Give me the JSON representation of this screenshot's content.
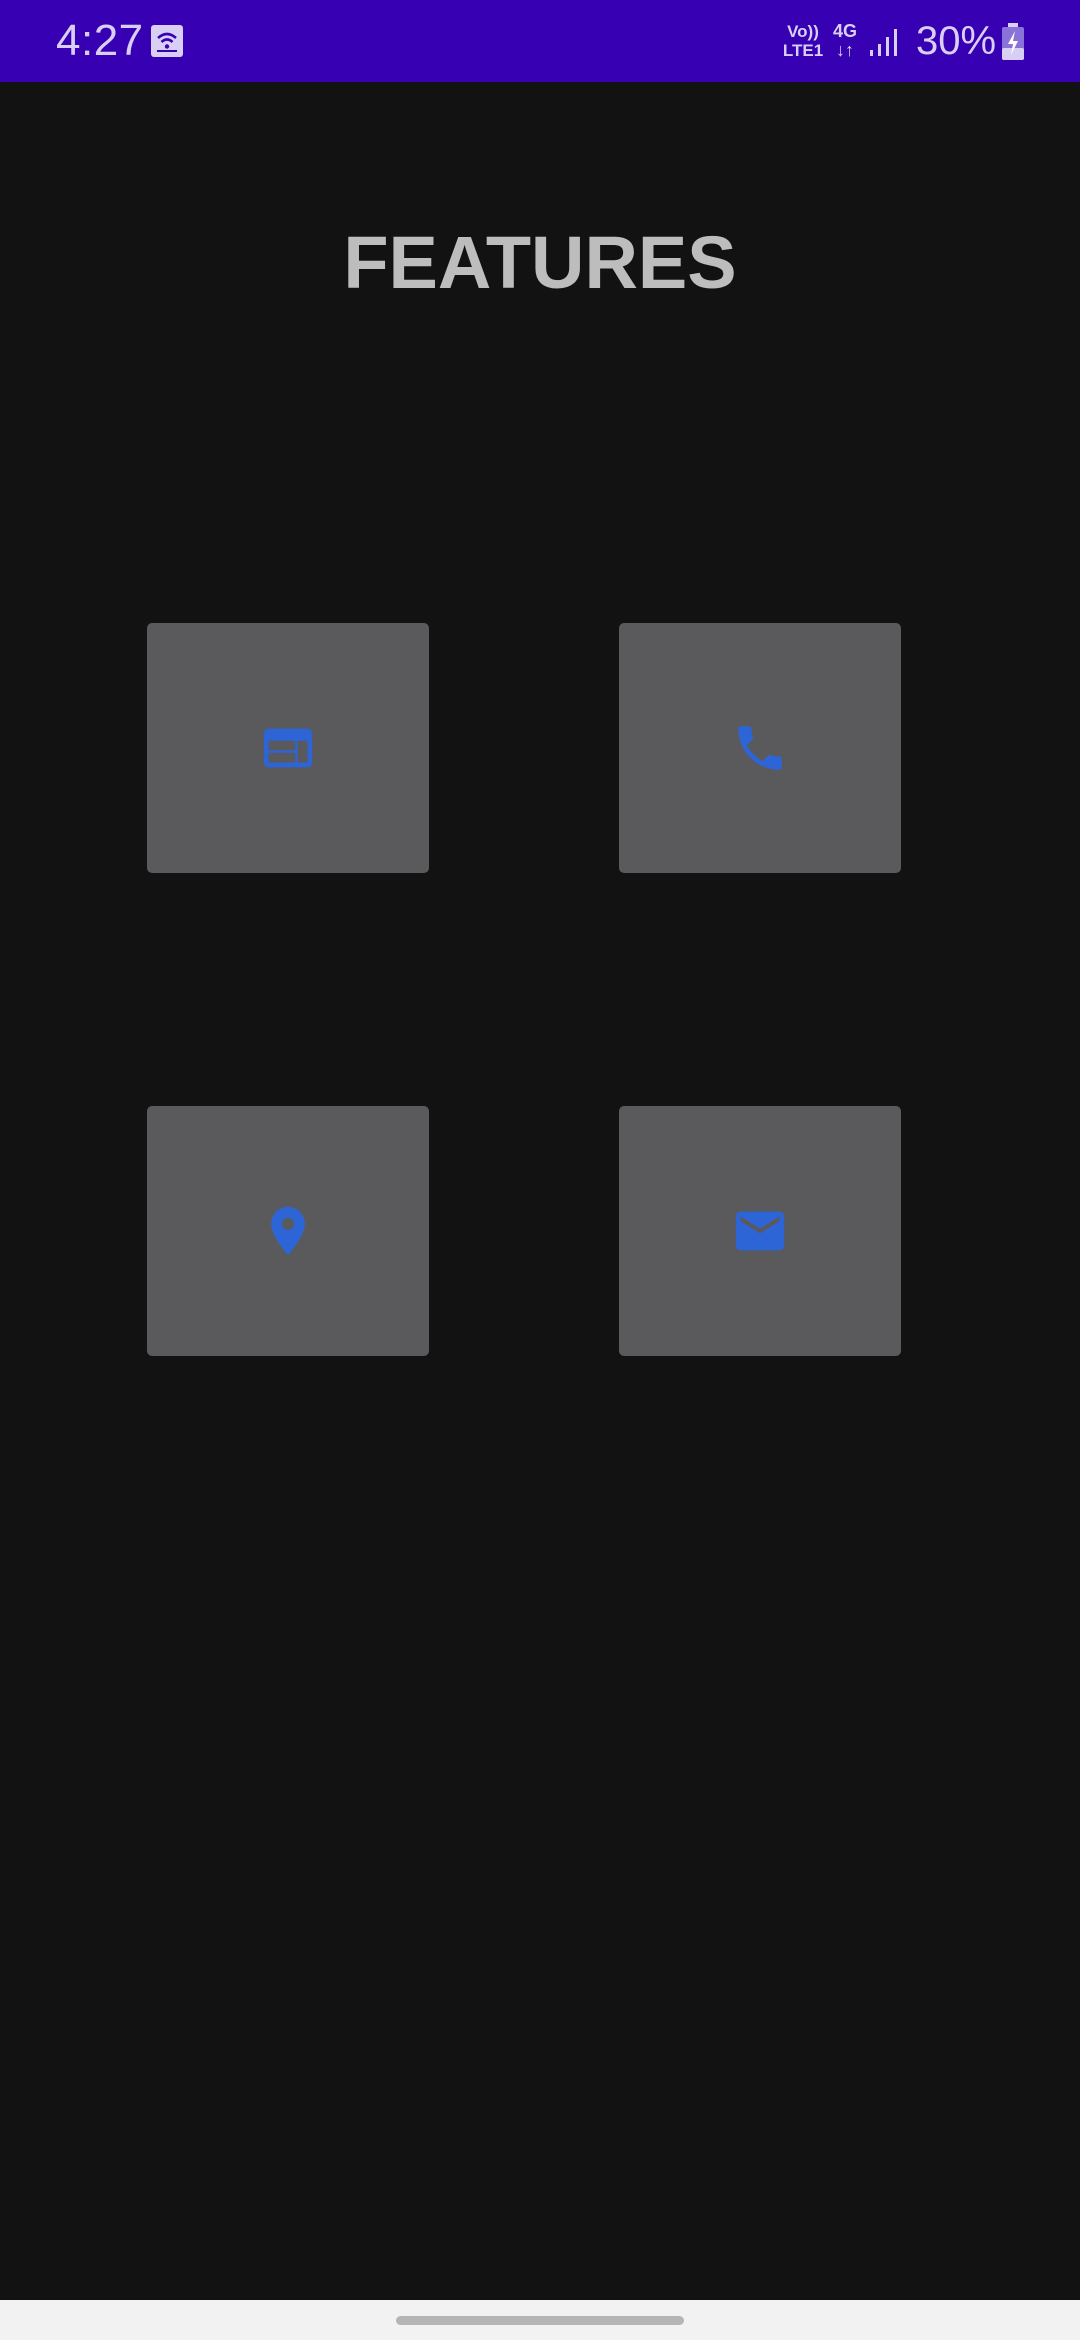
{
  "status_bar": {
    "time": "4:27",
    "notification_icon": "cast-wifi-icon",
    "volte_line1": "Vo))",
    "volte_line2": "LTE1",
    "network_line1": "4G",
    "network_line2": "↓↑",
    "signal_icon": "signal-bars-icon",
    "battery_percent": "30%",
    "battery_icon": "battery-charging-icon",
    "background_color": "#3700b3"
  },
  "page": {
    "title": "FEATURES",
    "background_color": "#121212",
    "title_color": "#bdbdbd"
  },
  "features": [
    {
      "icon": "web-browser-icon"
    },
    {
      "icon": "phone-icon"
    },
    {
      "icon": "location-pin-icon"
    },
    {
      "icon": "email-icon"
    }
  ],
  "colors": {
    "tile_background": "#5a5a5c",
    "icon_accent": "#2d64d6"
  }
}
